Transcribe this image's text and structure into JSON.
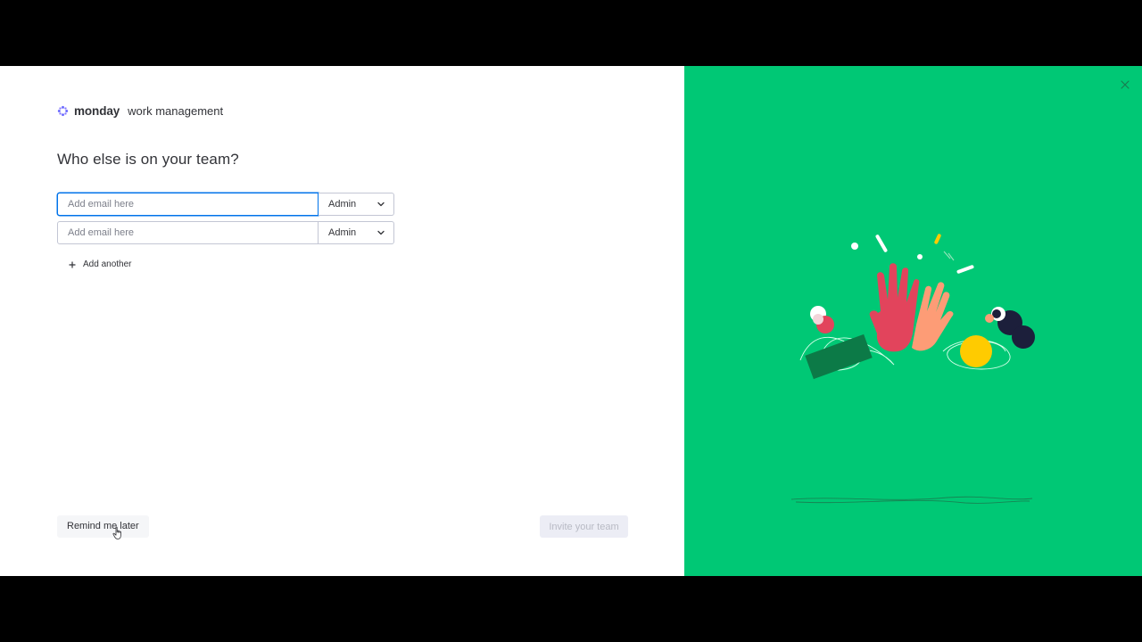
{
  "logo": {
    "brand": "monday",
    "product": "work management",
    "icon": "monday-logo-icon"
  },
  "title": "Who else is on your team?",
  "invites": [
    {
      "email_value": "",
      "email_placeholder": "Add email here",
      "role": "Admin",
      "focused": true
    },
    {
      "email_value": "",
      "email_placeholder": "Add email here",
      "role": "Admin",
      "focused": false
    }
  ],
  "add_another": {
    "label": "Add another",
    "icon": "plus-icon"
  },
  "footer": {
    "remind_label": "Remind me later",
    "invite_label": "Invite your team"
  },
  "panel": {
    "close_icon": "close-icon",
    "illustration": "high-five-illustration"
  },
  "colors": {
    "accent": "#0073ea",
    "panel_bg": "#00c875",
    "text": "#323338",
    "disabled_bg": "#ecedf5",
    "disabled_text": "#b8bac4"
  }
}
